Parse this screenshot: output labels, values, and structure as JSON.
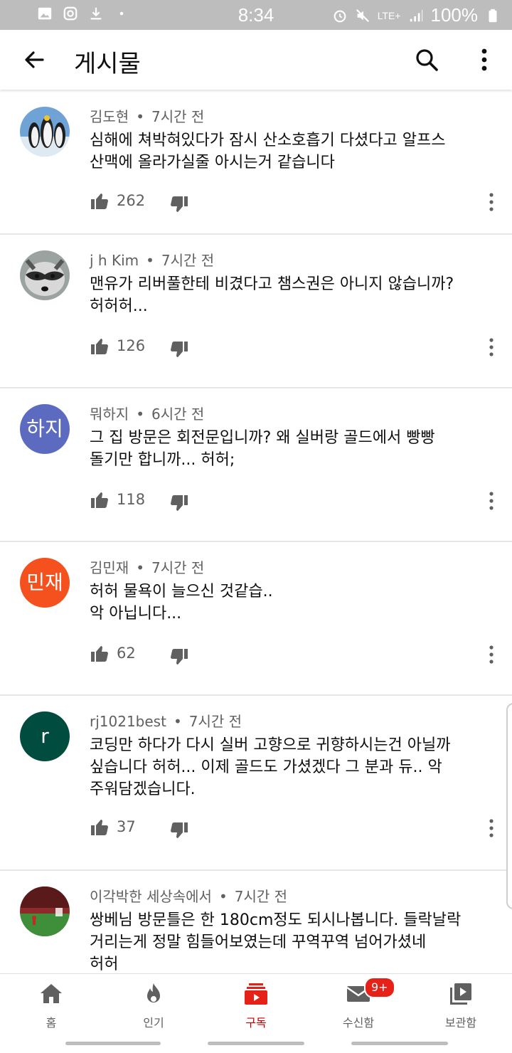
{
  "status_bar": {
    "time": "8:34",
    "network": "LTE+",
    "battery": "100%",
    "icons": [
      "image-icon",
      "instagram-icon",
      "download-icon",
      "dot-icon",
      "alarm-icon",
      "mute-icon",
      "signal-icon",
      "battery-icon"
    ]
  },
  "header": {
    "title": "게시물",
    "back_icon": "arrow-left-icon",
    "search_icon": "search-icon",
    "more_icon": "more-vert-icon"
  },
  "comments": [
    {
      "author": "김도현",
      "time": "7시간 전",
      "lines": [
        "심해에 쳐박혀있다가 잠시 산소호흡기 다셨다고 알프스",
        "산맥에 올라가실줄 아시는거 같습니다"
      ],
      "likes": "262",
      "avatar_type": "image",
      "avatar_desc": "penguins"
    },
    {
      "author": "j h Kim",
      "time": "7시간 전",
      "lines": [
        "맨유가 리버풀한테 비겼다고 챔스권은 아니지 않습니까?",
        "허허허..."
      ],
      "likes": "126",
      "avatar_type": "image",
      "avatar_desc": "raccoon"
    },
    {
      "author": "뭐하지",
      "time": "6시간 전",
      "lines": [
        "그 집 방문은 회전문입니까? 왜 실버랑 골드에서 빵빵",
        "돌기만 합니까... 허허;"
      ],
      "likes": "118",
      "avatar_type": "text",
      "avatar_text": "하지",
      "avatar_color": "#5c6bc0"
    },
    {
      "author": "김민재",
      "time": "7시간 전",
      "lines": [
        "허허 물욕이 늘으신 것같습..",
        "악 아닙니다..."
      ],
      "likes": "62",
      "avatar_type": "text",
      "avatar_text": "민재",
      "avatar_color": "#f4511e"
    },
    {
      "author": "rj1021best",
      "time": "7시간 전",
      "lines": [
        "코딩만 하다가 다시 실버 고향으로 귀향하시는건 아닐까",
        "싶습니다 허허... 이제 골드도 가셨겠다 그 분과 듀.. 악",
        "주워담겠습니다."
      ],
      "likes": "37",
      "avatar_type": "text",
      "avatar_text": "r",
      "avatar_color": "#004d40"
    },
    {
      "author": "이각박한 세상속에서",
      "time": "7시간 전",
      "lines": [
        "쌍베님 방문틀은 한 180cm정도 되시나봅니다. 들락날락",
        "거리는게 정말 힘들어보였는데 꾸역꾸역 넘어가셨네",
        "허허"
      ],
      "likes": "",
      "avatar_type": "image",
      "avatar_desc": "stadium"
    }
  ],
  "bottom_nav": {
    "items": [
      {
        "label": "홈",
        "icon": "home-icon"
      },
      {
        "label": "인기",
        "icon": "flame-icon"
      },
      {
        "label": "구독",
        "icon": "subscriptions-icon",
        "active": true
      },
      {
        "label": "수신함",
        "icon": "mail-icon",
        "badge": "9+"
      },
      {
        "label": "보관함",
        "icon": "library-icon"
      }
    ],
    "active_color": "#cc0000",
    "badge_color": "#e62117"
  }
}
